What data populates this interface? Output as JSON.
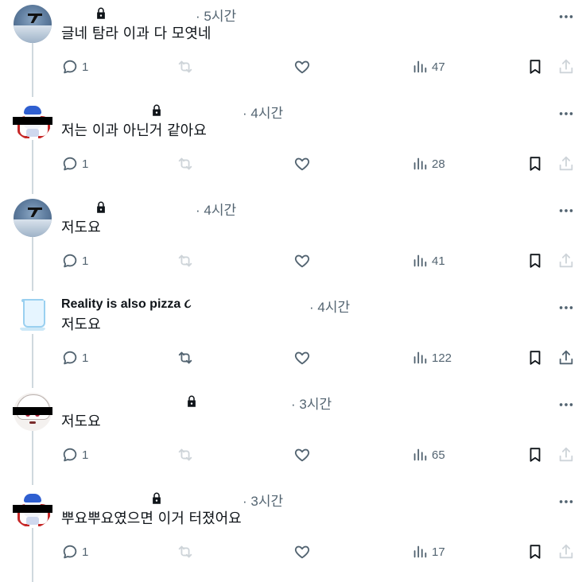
{
  "posts": [
    {
      "name": "",
      "locked": true,
      "time": "· 5시간",
      "text": "글네 탐라 이과 다 모엿네",
      "avatar": "ocean-avatar",
      "replies": "1",
      "views": "47",
      "repost_disabled": true
    },
    {
      "name": "",
      "locked": true,
      "time": "· 4시간",
      "text": "저는 이과 아닌거 같아요",
      "avatar": "character-avatar",
      "replies": "1",
      "views": "28",
      "repost_disabled": true
    },
    {
      "name": "",
      "locked": true,
      "time": "· 4시간",
      "text": "저도요",
      "avatar": "ocean-avatar",
      "replies": "1",
      "views": "41",
      "repost_disabled": true
    },
    {
      "name": "Reality is also pizza ૮",
      "locked": false,
      "time": "· 4시간",
      "text": "저도요",
      "avatar": "cup-avatar",
      "replies": "1",
      "views": "122",
      "repost_disabled": false
    },
    {
      "name": "",
      "locked": true,
      "time": "· 3시간",
      "text": "저도요",
      "avatar": "anime-avatar",
      "replies": "1",
      "views": "65",
      "repost_disabled": true
    },
    {
      "name": "",
      "locked": true,
      "time": "· 3시간",
      "text": "뿌요뿌요였으면 이거 터졌어요",
      "avatar": "character-avatar",
      "replies": "1",
      "views": "17",
      "repost_disabled": true
    }
  ],
  "icons": {
    "reply": "reply-icon",
    "repost": "repost-icon",
    "like": "heart-icon",
    "views": "views-icon",
    "bookmark": "bookmark-icon",
    "share": "share-icon",
    "more": "more-icon",
    "lock": "lock-icon"
  },
  "colors": {
    "text": "#0f1419",
    "secondary": "#536471",
    "thread_line": "#cfd9de",
    "disabled": "#a7b2bb"
  }
}
